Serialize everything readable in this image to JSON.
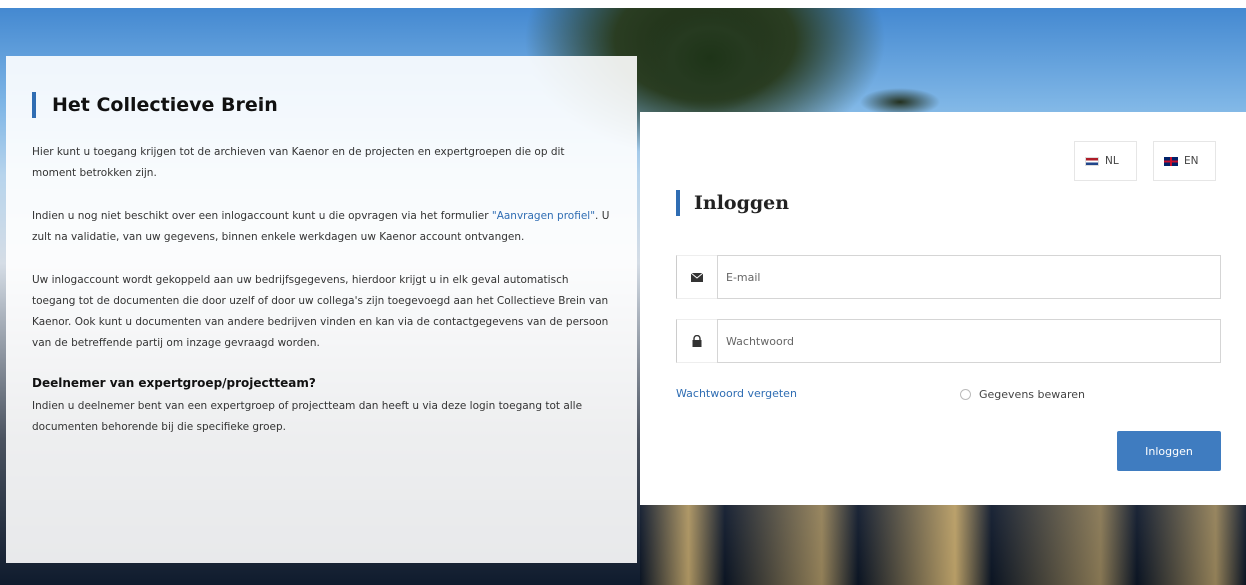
{
  "info": {
    "title": "Het Collectieve Brein",
    "p1": "Hier kunt u toegang krijgen tot de archieven van Kaenor en de projecten en expertgroepen die op dit moment betrokken zijn.",
    "p2_before": "Indien u nog niet beschikt over een inlogaccount kunt u die opvragen via het formulier ",
    "p2_link": "\"Aanvragen profiel\"",
    "p2_after": ". U zult na validatie, van uw gegevens, binnen enkele werkdagen uw Kaenor account ontvangen.",
    "p3": "Uw inlogaccount wordt gekoppeld aan uw bedrijfsgegevens, hierdoor krijgt u in elk geval automatisch toegang tot de documenten die door uzelf of door uw collega's zijn toegevoegd aan het Collectieve Brein van Kaenor. Ook kunt u documenten van andere bedrijven vinden en kan via de contactgegevens van de persoon van de betreffende partij om inzage gevraagd worden.",
    "subheading": "Deelnemer van expertgroep/projectteam?",
    "p4": "Indien u deelnemer bent van een expertgroep of projectteam dan heeft u via deze login toegang tot alle documenten behorende bij die specifieke groep."
  },
  "login": {
    "lang_nl": "NL",
    "lang_en": "EN",
    "title": "Inloggen",
    "email_placeholder": "E-mail",
    "password_placeholder": "Wachtwoord",
    "forgot_label": "Wachtwoord vergeten",
    "remember_label": "Gegevens bewaren",
    "submit_label": "Inloggen"
  },
  "icons": {
    "email": "envelope-icon",
    "password": "lock-icon"
  },
  "colors": {
    "accent": "#2f6db3",
    "button": "#3f7cc0"
  }
}
